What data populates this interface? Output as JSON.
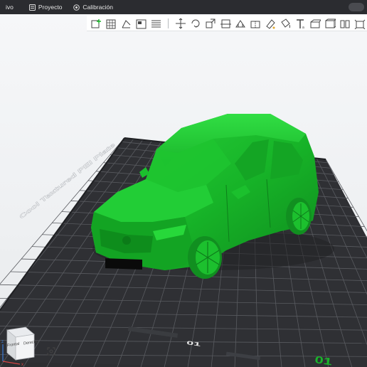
{
  "menubar": {
    "items": [
      {
        "label": "ivo",
        "icon": "none"
      },
      {
        "label": "Proyecto",
        "icon": "project-icon"
      },
      {
        "label": "Calibración",
        "icon": "calibration-icon"
      }
    ]
  },
  "toolbar": {
    "buttons": [
      "add-object-icon",
      "arrange-grid-icon",
      "orient-icon",
      "layout-icon",
      "list-icon",
      "move-icon",
      "rotate-icon",
      "scale-icon",
      "cut-icon",
      "support-icon",
      "seam-icon",
      "paint-icon",
      "fill-icon",
      "text-icon",
      "measure-icon",
      "assembly-icon",
      "split-icon",
      "explode-icon"
    ]
  },
  "plate": {
    "label_text": "Cool Textured PEI Plate",
    "plate_number": "01",
    "secondary_number": "01"
  },
  "navcube": {
    "front_label": "Frontal",
    "right_label": "Derecho"
  },
  "colors": {
    "model": "#19b52a",
    "plate": "#2d2e31",
    "grid": "#55575b",
    "accent": "#19b52a"
  }
}
